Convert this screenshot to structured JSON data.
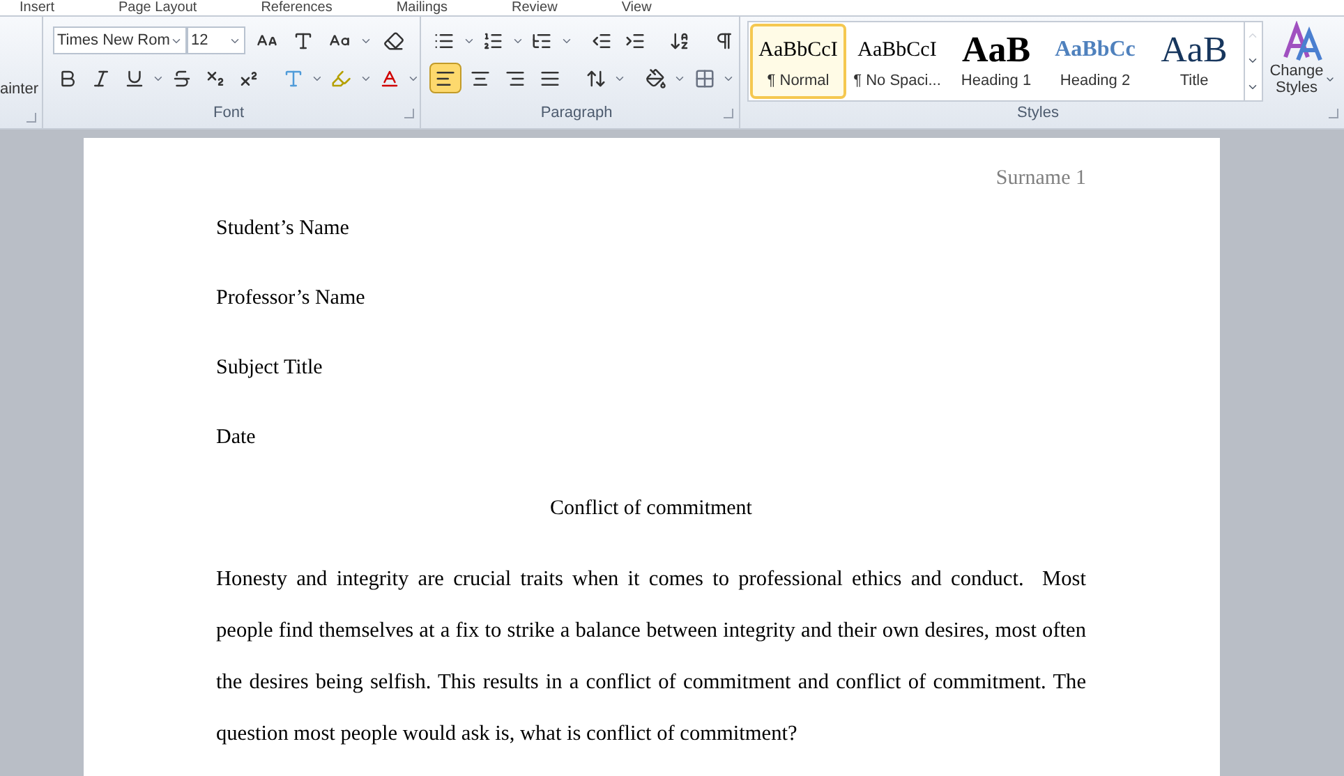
{
  "ribbon_tabs": [
    {
      "label": "Insert"
    },
    {
      "label": "Page Layout"
    },
    {
      "label": "References"
    },
    {
      "label": "Mailings"
    },
    {
      "label": "Review"
    },
    {
      "label": "View"
    }
  ],
  "clipboard": {
    "label": "ainter"
  },
  "font": {
    "font_name": "Times New Rom",
    "font_size": "12",
    "group_label": "Font"
  },
  "paragraph": {
    "group_label": "Paragraph",
    "alignments": [
      {
        "kind": "left",
        "selected": true
      },
      {
        "kind": "center",
        "selected": false
      },
      {
        "kind": "right",
        "selected": false
      },
      {
        "kind": "justify",
        "selected": false
      }
    ]
  },
  "styles": {
    "group_label": "Styles",
    "items": [
      {
        "kind": "normal",
        "preview": "AaBbCcI",
        "label": "¶ Normal",
        "selected": true
      },
      {
        "kind": "nospacing",
        "preview": "AaBbCcI",
        "label": "¶ No Spaci...",
        "selected": false
      },
      {
        "kind": "heading1",
        "preview": "AaB",
        "label": "Heading 1",
        "selected": false
      },
      {
        "kind": "heading2",
        "preview": "AaBbCc",
        "label": "Heading 2",
        "selected": false
      },
      {
        "kind": "title",
        "preview": "AaB",
        "label": "Title",
        "selected": false
      }
    ],
    "change_styles": "Change Styles"
  },
  "document": {
    "header": "Surname 1",
    "lines": [
      {
        "kind": "left",
        "text": "Student’s Name"
      },
      {
        "kind": "left",
        "text": "Professor’s Name"
      },
      {
        "kind": "left",
        "text": "Subject Title"
      },
      {
        "kind": "left",
        "text": "Date"
      },
      {
        "kind": "center",
        "text": "Conflict of commitment"
      }
    ],
    "body": "Honesty and integrity are crucial traits when it comes to professional ethics and conduct.  Most people find themselves at a fix to strike a balance between integrity and their own desires, most often the desires being selfish. This results in a conflict of commitment and conflict of commitment. The question most people would ask is, what is conflict of commitment?"
  }
}
